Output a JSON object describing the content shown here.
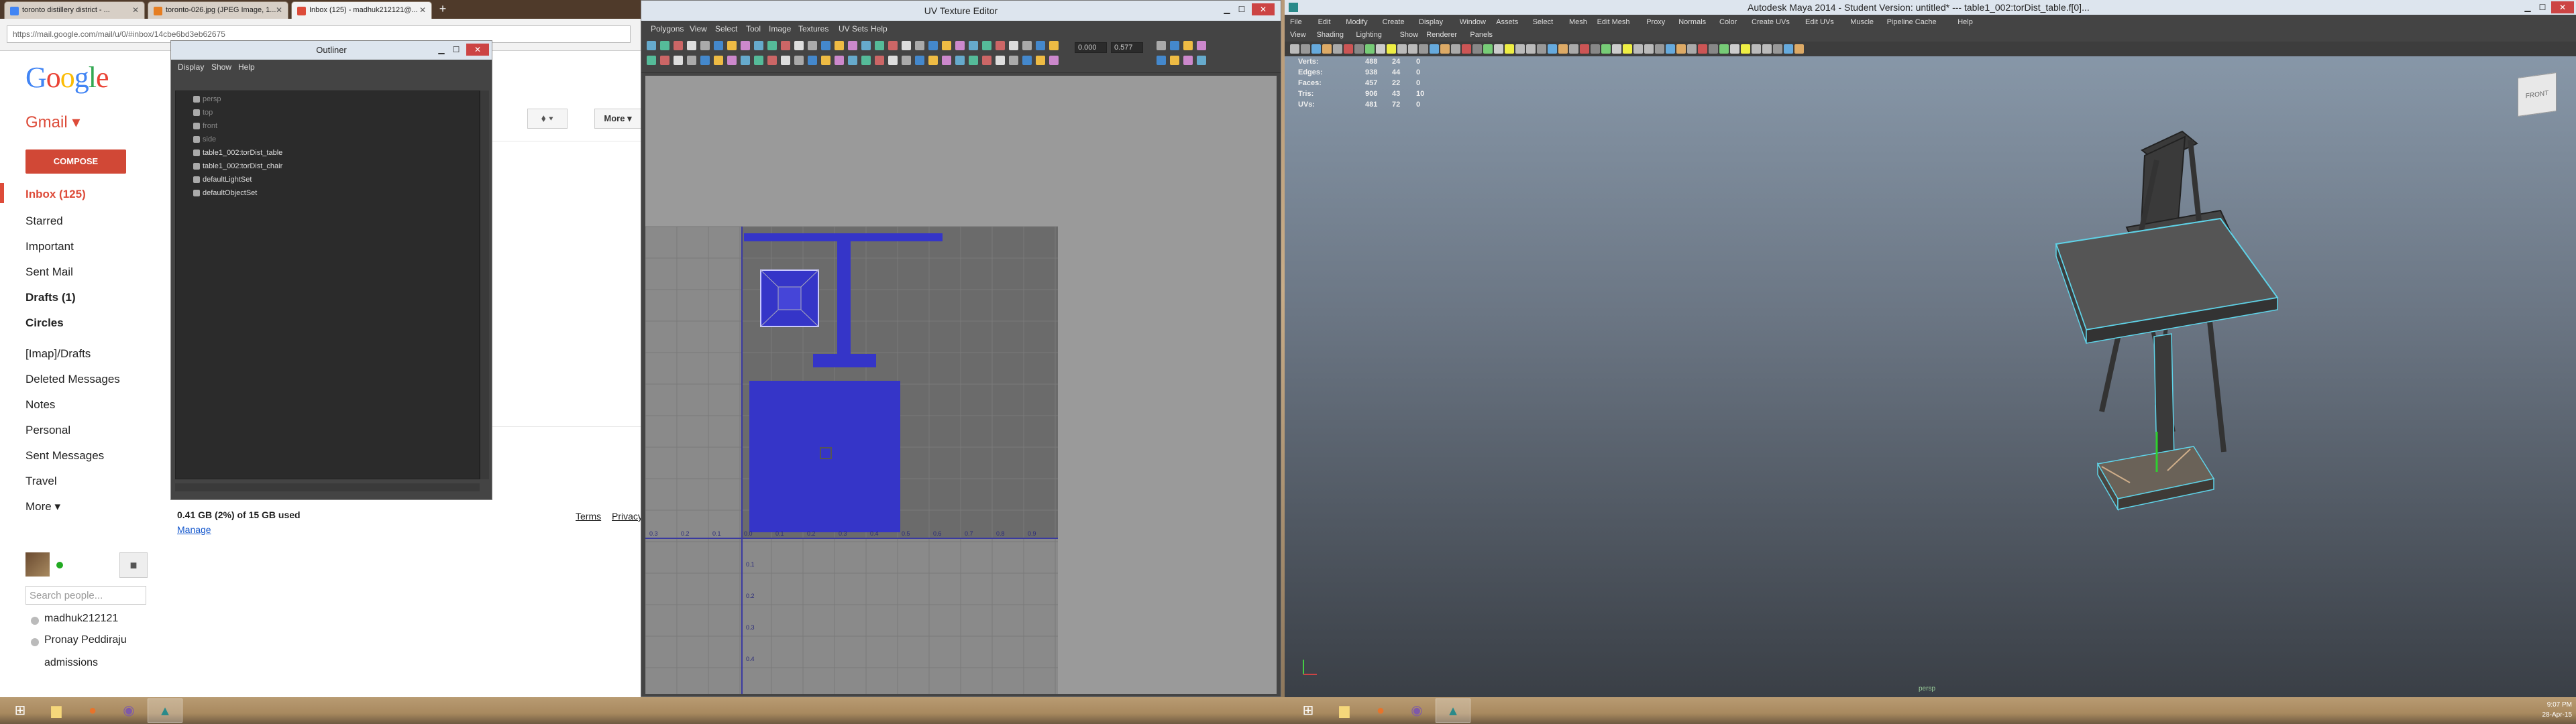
{
  "chrome": {
    "tabs": [
      {
        "label": "toronto distillery district - ...",
        "fav": "#4285f4"
      },
      {
        "label": "toronto-026.jpg (JPEG Image, 1...",
        "fav": "#e67e22"
      },
      {
        "label": "Inbox (125) - madhuk212121@...",
        "fav": "#dd4b39"
      }
    ],
    "new_tab": "+",
    "url": "https://mail.google.com/mail/u/0/#inbox/14cbe6bd3eb62675"
  },
  "gmail": {
    "logo": "Google",
    "label": "Gmail",
    "compose": "COMPOSE",
    "nav": [
      {
        "label": "Inbox (125)",
        "kind": "inbox"
      },
      {
        "label": "Starred",
        "kind": ""
      },
      {
        "label": "Important",
        "kind": ""
      },
      {
        "label": "Sent Mail",
        "kind": ""
      },
      {
        "label": "Drafts (1)",
        "kind": "bold"
      },
      {
        "label": "Circles",
        "kind": "bold"
      },
      {
        "label": "[Imap]/Drafts",
        "kind": ""
      },
      {
        "label": "Deleted Messages",
        "kind": ""
      },
      {
        "label": "Notes",
        "kind": ""
      },
      {
        "label": "Personal",
        "kind": ""
      },
      {
        "label": "Sent Messages",
        "kind": ""
      },
      {
        "label": "Travel",
        "kind": ""
      },
      {
        "label": "More",
        "kind": ""
      }
    ],
    "search_people_placeholder": "Search people...",
    "contacts": [
      "madhuk212121",
      "Pronay Peddiraju",
      "admissions"
    ],
    "toolbar_more": "More",
    "storage": "0.41 GB (2%) of 15 GB used",
    "manage": "Manage",
    "terms": "Terms",
    "privacy": "Privacy"
  },
  "outliner": {
    "title": "Outliner",
    "menu": [
      "Display",
      "Show",
      "Help"
    ],
    "items": [
      {
        "label": "persp",
        "dim": true
      },
      {
        "label": "top",
        "dim": true
      },
      {
        "label": "front",
        "dim": true
      },
      {
        "label": "side",
        "dim": true
      },
      {
        "label": "table1_002:torDist_table",
        "dim": false
      },
      {
        "label": "table1_002:torDist_chair",
        "dim": false
      },
      {
        "label": "defaultLightSet",
        "dim": false
      },
      {
        "label": "defaultObjectSet",
        "dim": false
      }
    ]
  },
  "uv_editor": {
    "title": "UV Texture Editor",
    "menu": [
      "Polygons",
      "View",
      "Select",
      "Tool",
      "Image",
      "Textures",
      "UV Sets",
      "Help"
    ],
    "field_u": "0.000",
    "field_v": "0.577",
    "axis_labels_x": [
      "0.3",
      "0.2",
      "0.1",
      "0.0",
      "0.1",
      "0.2",
      "0.3",
      "0.4",
      "0.5",
      "0.6",
      "0.7",
      "0.8",
      "0.9"
    ],
    "axis_labels_y": [
      "0.1",
      "0.2",
      "0.3",
      "0.4"
    ]
  },
  "maya": {
    "title": "Autodesk Maya 2014 - Student Version: untitled*   ---   table1_002:torDist_table.f[0]...",
    "menu": [
      "File",
      "Edit",
      "Modify",
      "Create",
      "Display",
      "Window",
      "Assets",
      "Select",
      "Mesh",
      "Edit Mesh",
      "Proxy",
      "Normals",
      "Color",
      "Create UVs",
      "Edit UVs",
      "Muscle",
      "Pipeline Cache",
      "Help"
    ],
    "panel_menu": [
      "View",
      "Shading",
      "Lighting",
      "Show",
      "Renderer",
      "Panels"
    ],
    "hud": [
      {
        "label": "Verts:",
        "a": "488",
        "b": "24",
        "c": "0"
      },
      {
        "label": "Edges:",
        "a": "938",
        "b": "44",
        "c": "0"
      },
      {
        "label": "Faces:",
        "a": "457",
        "b": "22",
        "c": "0"
      },
      {
        "label": "Tris:",
        "a": "906",
        "b": "43",
        "c": "10"
      },
      {
        "label": "UVs:",
        "a": "481",
        "b": "72",
        "c": "0"
      }
    ],
    "viewcube": "FRONT",
    "camera": "persp"
  },
  "taskbar": {
    "time": "9:07 PM",
    "date": "28-Apr-15"
  },
  "colors": {
    "uv_shell": "#3535c8",
    "gmail_red": "#dd4b39",
    "maya_highlight": "#5fd3e8"
  }
}
